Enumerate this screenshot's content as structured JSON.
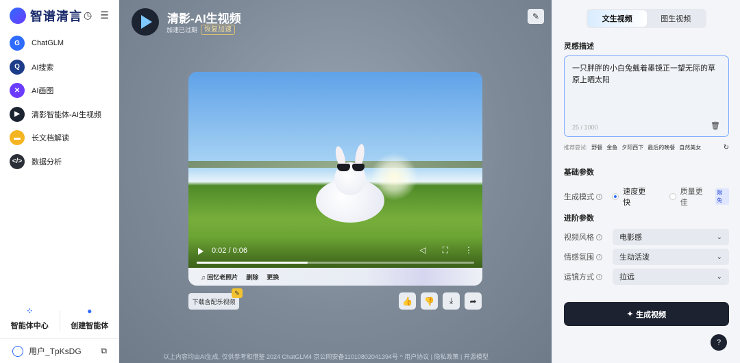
{
  "sidebar": {
    "logo_text": "智谱清言",
    "items": [
      {
        "label": "ChatGLM",
        "icon": "chatglm-icon",
        "color": "#2f6bff",
        "glyph": "G"
      },
      {
        "label": "AI搜索",
        "icon": "ai-search-icon",
        "color": "#1d3c8a",
        "glyph": "Q"
      },
      {
        "label": "AI画图",
        "icon": "ai-draw-icon",
        "color": "#6b3cff",
        "glyph": "✕"
      },
      {
        "label": "清影智能体-AI生视频",
        "icon": "qingying-icon",
        "color": "#1c2431",
        "glyph": "▶"
      },
      {
        "label": "长文档解读",
        "icon": "document-icon",
        "color": "#f5b521",
        "glyph": "▬"
      },
      {
        "label": "数据分析",
        "icon": "code-icon",
        "color": "#2a2e36",
        "glyph": "</>"
      }
    ],
    "agent_center_label": "智能体中心",
    "create_agent_label": "创建智能体",
    "user_name": "用户_TpKsDG"
  },
  "main": {
    "title": "清影-AI生视频",
    "subtitle": "加速已过期",
    "restore_label": "恢复加速",
    "video": {
      "time": "0:02 / 0:06",
      "progress": 0.4
    },
    "video_bar": {
      "memory_label": "♫ 回忆老照片",
      "delete_label": "删除",
      "replace_label": "更换"
    },
    "download_music_label": "下载含配乐视频",
    "footer": "以上内容均由AI生成, 仅供参考和借鉴  2024 ChatGLM4 京公网安备11010802041394号 ^ 用户协议 | 隐私政策 | 开源模型"
  },
  "panel": {
    "tabs": [
      {
        "label": "文生视频",
        "active": true
      },
      {
        "label": "图生视频",
        "active": false
      }
    ],
    "inspiration_label": "灵感描述",
    "prompt_text": "一只胖胖的小白兔戴着墨镜正一望无际的草原上晒太阳",
    "prompt_count": "25 / 1000",
    "recommend_label": "推荐尝试:",
    "recommendations": [
      "野餐",
      "金鱼",
      "夕阳西下",
      "最后的晚餐",
      "自然美女"
    ],
    "basic_params_label": "基础参数",
    "gen_mode_label": "生成模式",
    "mode_fast": "速度更快",
    "mode_quality": "质量更佳",
    "limited_badge": "限免",
    "advanced_params_label": "进阶参数",
    "selects": [
      {
        "label": "视频风格",
        "value": "电影感"
      },
      {
        "label": "情感氛围",
        "value": "生动活泼"
      },
      {
        "label": "运镜方式",
        "value": "拉远"
      }
    ],
    "generate_label": "生成视频"
  }
}
